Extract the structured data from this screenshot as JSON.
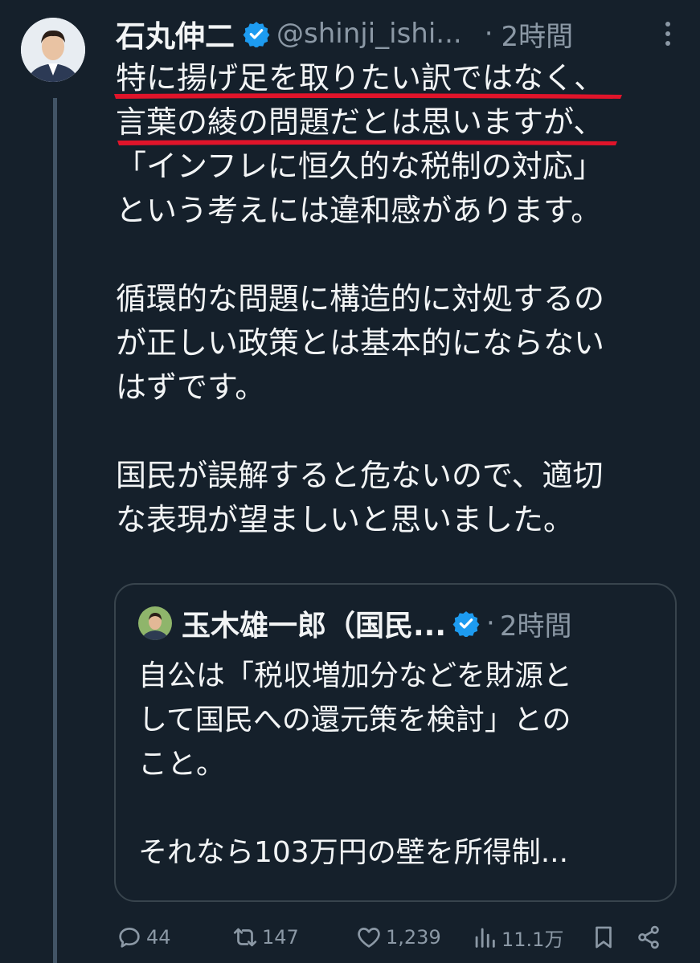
{
  "tweet": {
    "author_name": "石丸伸二",
    "handle": "@shinji_ishi...",
    "separator": "·",
    "time": "2時間",
    "paragraphs": [
      [
        "特に揚げ足を取りたい訳ではなく、",
        "言葉の綾の問題だとは思いますが、",
        "「インフレに恒久的な税制の対応」",
        "という考えには違和感があります。"
      ],
      [
        "循環的な問題に構造的に対処するの",
        "が正しい政策とは基本的にならない",
        "はずです。"
      ],
      [
        "国民が誤解すると危ないので、適切",
        "な表現が望ましいと思いました。"
      ]
    ]
  },
  "quote": {
    "author_name": "玉木雄一郎（国民...",
    "separator": "·",
    "time": "2時間",
    "paragraphs": [
      [
        "自公は「税収増加分などを財源と",
        "して国民への還元策を検討」との",
        "こと。"
      ],
      [
        "それなら103万円の壁を所得制..."
      ]
    ]
  },
  "actions": {
    "replies": "44",
    "retweets": "147",
    "likes": "1,239",
    "views": "11.1万"
  },
  "colors": {
    "background": "#15202b",
    "text": "#e7e9ea",
    "muted": "#8b98a5",
    "verified": "#1d9bf0",
    "underline": "#e0142a"
  }
}
